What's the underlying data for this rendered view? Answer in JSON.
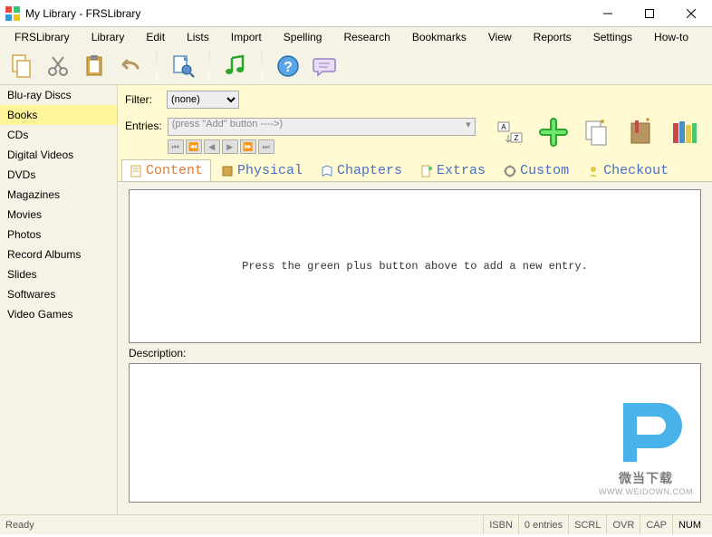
{
  "window": {
    "title": "My Library - FRSLibrary"
  },
  "menu": {
    "items": [
      "FRSLibrary",
      "Library",
      "Edit",
      "Lists",
      "Import",
      "Spelling",
      "Research",
      "Bookmarks",
      "View",
      "Reports",
      "Settings",
      "How-to"
    ]
  },
  "sidebar": {
    "items": [
      "Blu-ray Discs",
      "Books",
      "CDs",
      "Digital Videos",
      "DVDs",
      "Magazines",
      "Movies",
      "Photos",
      "Record Albums",
      "Slides",
      "Softwares",
      "Video Games"
    ],
    "selected": 1
  },
  "filter": {
    "label": "Filter:",
    "value": "(none)"
  },
  "entries": {
    "label": "Entries:",
    "placeholder": "(press \"Add\" button ---->)"
  },
  "tabs": {
    "items": [
      "Content",
      "Physical",
      "Chapters",
      "Extras",
      "Custom",
      "Checkout"
    ],
    "selected": 0
  },
  "main": {
    "hint": "Press the green plus button above to add a new entry."
  },
  "description": {
    "label": "Description:"
  },
  "status": {
    "ready": "Ready",
    "isbn": "ISBN",
    "entries": "0 entries",
    "scrl": "SCRL",
    "ovr": "OVR",
    "cap": "CAP",
    "num": "NUM"
  },
  "watermark": {
    "line1": "微当下载",
    "line2": "WWW.WEIDOWN.COM"
  }
}
